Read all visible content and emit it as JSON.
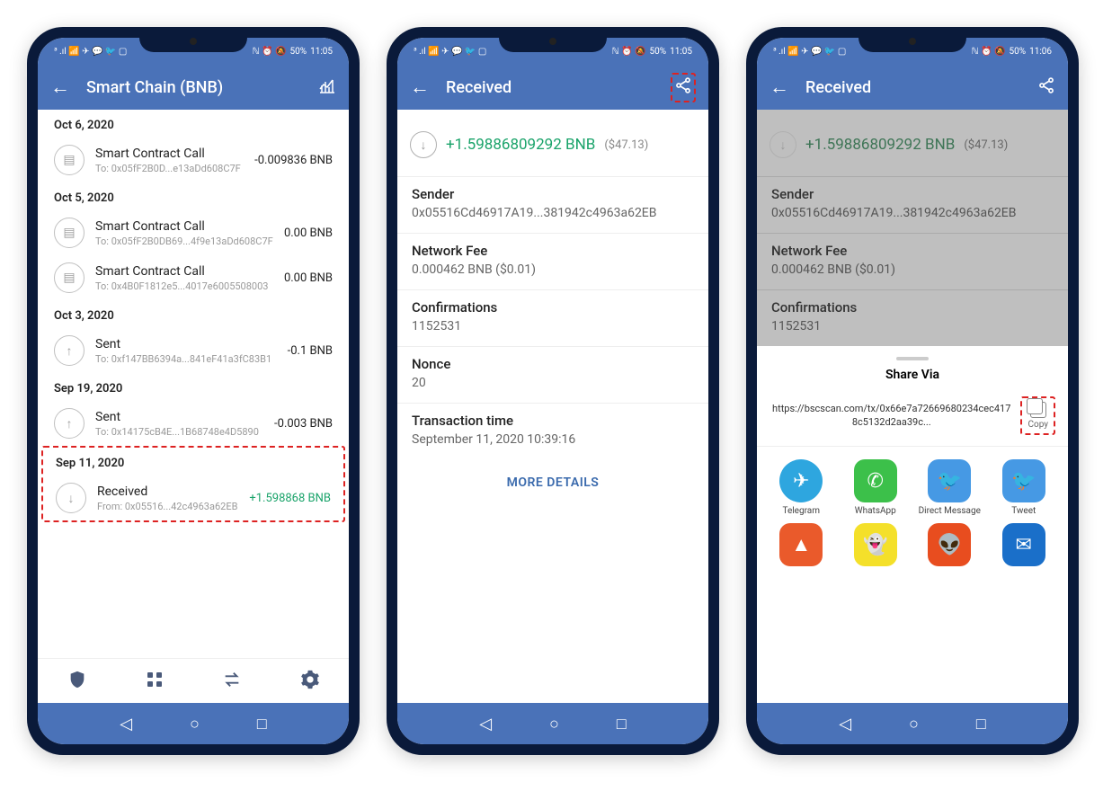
{
  "colors": {
    "headerBg": "#4a72b8",
    "accentGreen": "#1aa36a",
    "highlightRed": "#d22"
  },
  "phone1": {
    "statusTime": "11:05",
    "statusBattery": "50%",
    "statusLeft": "³ .ıl 📶 ✈ 💬 🐦 ▢",
    "statusRight": "ℕ ⏰ 🔕",
    "header": {
      "title": "Smart Chain (BNB)"
    },
    "groups": [
      {
        "date": "Oct 6, 2020",
        "txs": [
          {
            "type": "contract",
            "title": "Smart Contract Call",
            "sub": "To: 0x05fF2B0D...e13aDd608C7F",
            "amount": "-0.009836 BNB"
          }
        ]
      },
      {
        "date": "Oct 5, 2020",
        "txs": [
          {
            "type": "contract",
            "title": "Smart Contract Call",
            "sub": "To: 0x05fF2B0DB69...4f9e13aDd608C7F",
            "amount": "0.00 BNB"
          },
          {
            "type": "contract",
            "title": "Smart Contract Call",
            "sub": "To: 0x4B0F1812e5...4017e6005508003",
            "amount": "0.00 BNB"
          }
        ]
      },
      {
        "date": "Oct 3, 2020",
        "txs": [
          {
            "type": "sent",
            "title": "Sent",
            "sub": "To: 0xf147BB6394a...841eF41a3fC83B1",
            "amount": "-0.1 BNB"
          }
        ]
      },
      {
        "date": "Sep 19, 2020",
        "txs": [
          {
            "type": "sent",
            "title": "Sent",
            "sub": "To: 0x14175cB4E...1B68748e4D5890",
            "amount": "-0.003 BNB"
          }
        ]
      },
      {
        "date": "Sep 11, 2020",
        "txs": [
          {
            "type": "received",
            "title": "Received",
            "sub": "From: 0x05516...42c4963a62EB",
            "amount": "+1.598868 BNB",
            "highlighted": true
          }
        ]
      }
    ],
    "nav": {
      "shield": "shield-icon",
      "grid": "grid-icon",
      "swap": "swap-icon",
      "gear": "gear-icon"
    }
  },
  "phone2": {
    "statusTime": "11:05",
    "statusBattery": "50%",
    "statusLeft": "³ .ıl 📶 ✈ 💬 🐦 ▢",
    "statusRight": "ℕ ⏰ 🔕",
    "header": {
      "title": "Received",
      "shareHighlighted": true
    },
    "amount": "+1.59886809292 BNB",
    "amountUsd": "($47.13)",
    "details": [
      {
        "label": "Sender",
        "value": "0x05516Cd46917A19...381942c4963a62EB"
      },
      {
        "label": "Network Fee",
        "value": "0.000462 BNB ($0.01)"
      },
      {
        "label": "Confirmations",
        "value": "1152531"
      },
      {
        "label": "Nonce",
        "value": "20"
      },
      {
        "label": "Transaction time",
        "value": "September 11, 2020 10:39:16"
      }
    ],
    "moreDetails": "MORE DETAILS"
  },
  "phone3": {
    "statusTime": "11:06",
    "statusBattery": "50%",
    "statusLeft": "³ .ıl 📶 ✈ 💬 🐦 ▢",
    "statusRight": "ℕ ⏰ 🔕",
    "header": {
      "title": "Received"
    },
    "amount": "+1.59886809292 BNB",
    "amountUsd": "($47.13)",
    "details": [
      {
        "label": "Sender",
        "value": "0x05516Cd46917A19...381942c4963a62EB"
      },
      {
        "label": "Network Fee",
        "value": "0.000462 BNB ($0.01)"
      },
      {
        "label": "Confirmations",
        "value": "1152531"
      }
    ],
    "shareSheet": {
      "title": "Share Via",
      "url": "https://bscscan.com/tx/0x66e7a72669680234cec4178c5132d2aa39c...",
      "copyLabel": "Copy",
      "copyHighlighted": true,
      "apps": [
        {
          "name": "Telegram",
          "icon": "telegram"
        },
        {
          "name": "WhatsApp",
          "icon": "whatsapp"
        },
        {
          "name": "Direct Message",
          "icon": "twitter"
        },
        {
          "name": "Tweet",
          "icon": "twitter"
        },
        {
          "name": "",
          "icon": "strava"
        },
        {
          "name": "",
          "icon": "snap"
        },
        {
          "name": "",
          "icon": "reddit"
        },
        {
          "name": "",
          "icon": "outlook"
        }
      ]
    }
  }
}
